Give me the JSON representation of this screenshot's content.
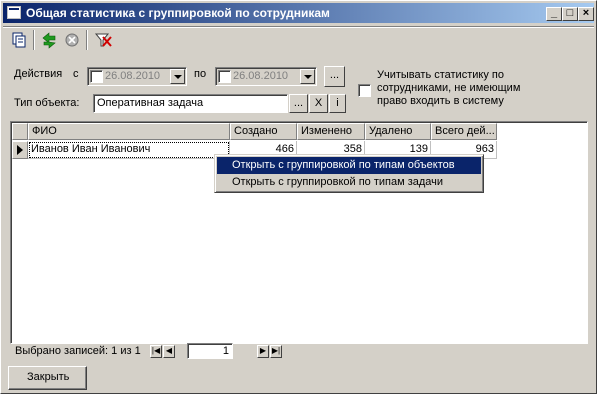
{
  "window": {
    "title": "Общая статистика с группировкой по сотрудникам"
  },
  "filters": {
    "actions_label": "Действия",
    "from_label": "с",
    "to_label": "по",
    "date_from": "26.08.2010",
    "date_to": "26.08.2010",
    "ellipsis": "...",
    "object_type_label": "Тип объекта:",
    "object_type_value": "Оперативная задача",
    "clear_symbol": "X",
    "info_symbol": "i",
    "include_stats_label_1": "Учитывать статистику по",
    "include_stats_label_2": "сотрудниками, не имеющим",
    "include_stats_label_3": "право входить в систему"
  },
  "grid": {
    "columns": [
      "ФИО",
      "Создано",
      "Изменено",
      "Удалено",
      "Всего дей..."
    ],
    "rows": [
      {
        "name": "Иванов Иван Иванович",
        "created": "466",
        "changed": "358",
        "deleted": "139",
        "total": "963"
      }
    ]
  },
  "context_menu": {
    "items": [
      "Открыть с группировкой по типам объектов",
      "Открыть с группировкой по типам задачи"
    ],
    "selected_index": 0
  },
  "status": {
    "selected_text": "Выбрано записей: 1 из 1",
    "page": "1",
    "total_pages": "1"
  },
  "buttons": {
    "close_label": "Закрыть"
  },
  "icons": [
    "app-icon",
    "copy-icon",
    "refresh-icon",
    "stop-icon",
    "clear-filter-icon"
  ]
}
